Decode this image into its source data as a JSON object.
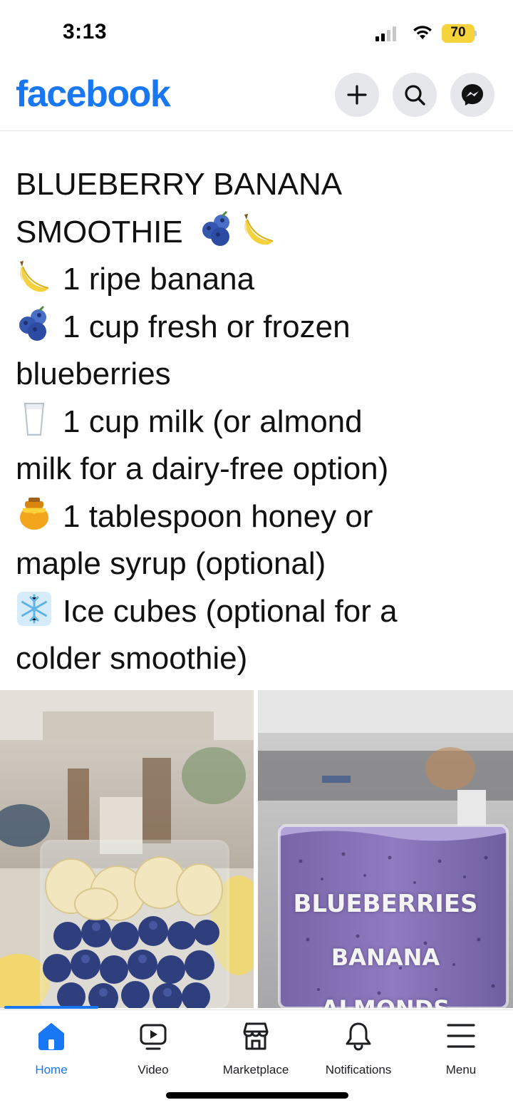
{
  "status_bar": {
    "time": "3:13",
    "battery_level": "70",
    "battery_color": "#f6d33b"
  },
  "header": {
    "logo": "facebook",
    "brand_color": "#1877f2",
    "buttons": [
      "plus-icon",
      "search-icon",
      "messenger-icon"
    ]
  },
  "post": {
    "lines": [
      {
        "text": "BLUEBERRY BANANA",
        "icon": null
      },
      {
        "text": "SMOOTHIE",
        "icon": null,
        "trailing_icons": [
          "blueberries-emoji",
          "banana-emoji"
        ]
      },
      {
        "text": "1 ripe banana",
        "icon": "banana-emoji"
      },
      {
        "text": "1 cup fresh or frozen",
        "icon": "blueberries-emoji"
      },
      {
        "text": "blueberries",
        "icon": null
      },
      {
        "text": "1 cup milk (or almond",
        "icon": "milk-glass-emoji"
      },
      {
        "text": "milk for a dairy-free option)",
        "icon": null
      },
      {
        "text": "1 tablespoon honey or",
        "icon": "honey-pot-emoji"
      },
      {
        "text": "maple syrup (optional)",
        "icon": null
      },
      {
        "text": "Ice cubes (optional for a",
        "icon": "snowflake-emoji"
      },
      {
        "text": "colder smoothie)",
        "icon": null
      }
    ],
    "images": [
      {
        "name": "blender-with-banana-and-blueberries"
      },
      {
        "name": "blended-blueberry-smoothie",
        "overlay_lines": [
          "BLUEBERRIES",
          "BANANA",
          "ALMONDS"
        ]
      }
    ]
  },
  "bottom_nav": {
    "items": [
      {
        "label": "Home",
        "icon": "home-icon",
        "active": true
      },
      {
        "label": "Video",
        "icon": "video-icon",
        "active": false
      },
      {
        "label": "Marketplace",
        "icon": "marketplace-icon",
        "active": false
      },
      {
        "label": "Notifications",
        "icon": "bell-icon",
        "active": false
      },
      {
        "label": "Menu",
        "icon": "menu-icon",
        "active": false
      }
    ]
  }
}
